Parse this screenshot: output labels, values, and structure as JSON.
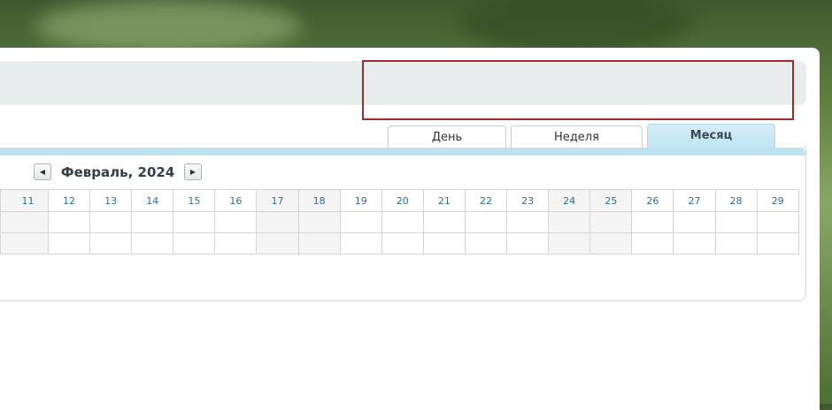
{
  "view_tabs": [
    {
      "label": "День",
      "active": false
    },
    {
      "label": "Неделя",
      "active": false
    },
    {
      "label": "Месяц",
      "active": true
    }
  ],
  "calendar": {
    "title": "Февраль, 2024",
    "prev_icon": "triangle-left-icon",
    "next_icon": "triangle-right-icon",
    "days": [
      "11",
      "12",
      "13",
      "14",
      "15",
      "16",
      "17",
      "18",
      "19",
      "20",
      "21",
      "22",
      "23",
      "24",
      "25",
      "26",
      "27",
      "28",
      "29"
    ],
    "weekend_days": [
      "11",
      "17",
      "18",
      "24",
      "25"
    ]
  },
  "colors": {
    "tab_active": "#c0e3f2",
    "highlight_border": "#a32a2a",
    "day_number": "#2e6a9a"
  }
}
